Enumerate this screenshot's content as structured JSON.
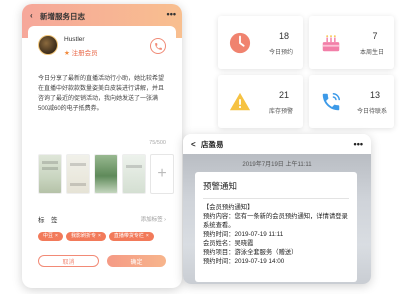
{
  "service_log": {
    "back": "‹",
    "title": "新增服务日志",
    "more": "•••",
    "user_name": "Hustler",
    "user_badge": "注册会员",
    "content": "今日分享了最新的直播活动行小助，她比较希望在直播中好款款数量姿美白皮装进行讲解，并且咨询了最近的促销活动，我向她发送了一张满500减60的电子抵费券。",
    "char_count": "75/500",
    "tag_label": "标　签",
    "tag_add": "添加标签",
    "tags": [
      "中豆",
      "我影刷折专",
      "直播带货专栏"
    ],
    "cancel": "取消",
    "submit": "确定"
  },
  "stats": [
    {
      "number": "18",
      "label": "今日预约",
      "icon": "clock-icon",
      "color": "#f0836f"
    },
    {
      "number": "7",
      "label": "本周生日",
      "icon": "cake-icon",
      "color": "#f27fa8"
    },
    {
      "number": "21",
      "label": "库存预警",
      "icon": "warning-icon",
      "color": "#f6c242"
    },
    {
      "number": "13",
      "label": "今日待联系",
      "icon": "phone-call-icon",
      "color": "#3d9ae8"
    }
  ],
  "message": {
    "back": "<",
    "title": "店盈易",
    "more": "•••",
    "timestamp": "2019年7月19日 上午11:11",
    "title_text": "预警通知",
    "lines": [
      "【会员预约通知】",
      "预约内容：您有一条新的会员预约通知，详情请登录系统查看。",
      "预约时间：2019-07-19 11:11",
      "会员姓名：吴晓霞",
      "预约项目：游泳全套服务（赠送）",
      "预约时间：2019-07-19 14:00"
    ]
  }
}
